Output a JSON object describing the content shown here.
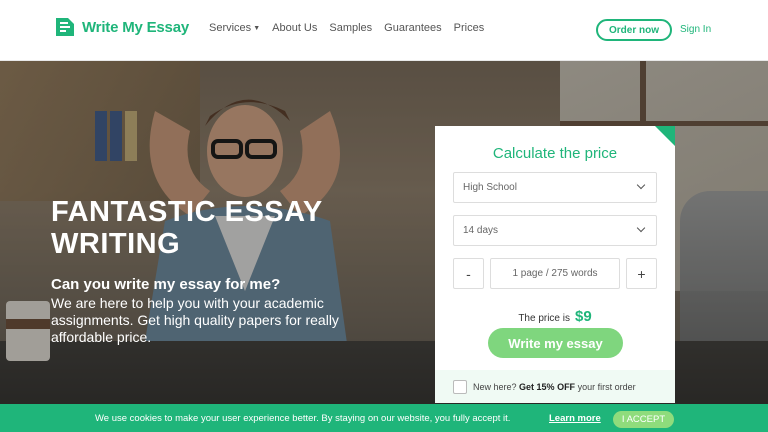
{
  "header": {
    "brand": "Write My Essay",
    "nav": [
      {
        "label": "Services",
        "has_dropdown": true
      },
      {
        "label": "About Us",
        "has_dropdown": false
      },
      {
        "label": "Samples",
        "has_dropdown": false
      },
      {
        "label": "Guarantees",
        "has_dropdown": false
      },
      {
        "label": "Prices",
        "has_dropdown": false
      }
    ],
    "order_label": "Order now",
    "signin_label": "Sign In"
  },
  "hero": {
    "title": "FANTASTIC ESSAY WRITING",
    "question": "Can you write my essay for me?",
    "description": "We are here to help you with your academic assignments. Get high quality papers for really affordable price."
  },
  "calculator": {
    "title": "Calculate the price",
    "level": "High School",
    "deadline": "14 days",
    "minus": "-",
    "plus": "+",
    "pages": "1 page / 275 words",
    "price_label": "The price is",
    "price": "$9",
    "cta": "Write my essay",
    "promo_prefix": "New here?",
    "promo_bold": "Get 15% OFF",
    "promo_suffix": "your first order"
  },
  "cookie": {
    "text": "We use cookies to make your user experience better. By staying on our website, you fully accept it.",
    "link": "Learn more",
    "accept": "I ACCEPT"
  },
  "colors": {
    "brand": "#1fb57a",
    "button_light": "#7fd67e"
  },
  "icons": {
    "logo": "logo-icon",
    "dropdown": "chevron-down-icon"
  }
}
